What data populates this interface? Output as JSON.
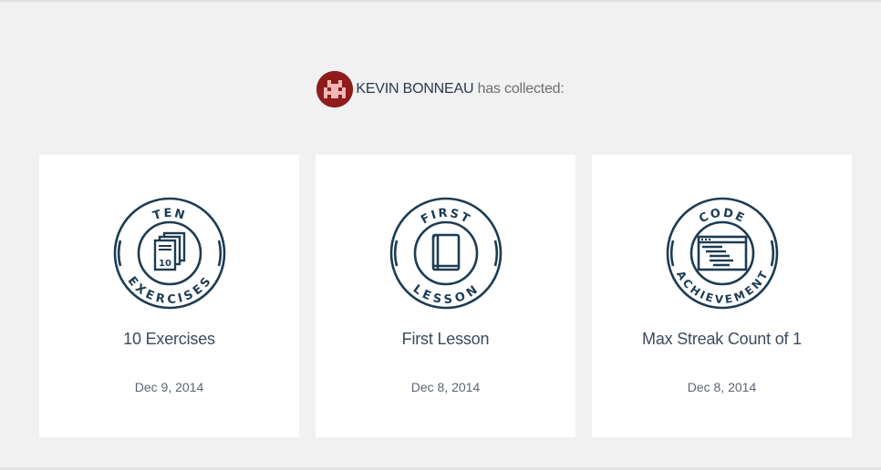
{
  "header": {
    "user_name": "KEVIN BONNEAU",
    "suffix": "has collected:",
    "avatar_icon": "space-invader-avatar",
    "avatar_color": "#8f1b1b"
  },
  "accent_color": "#1d3c52",
  "badges": [
    {
      "ring_top": "TEN",
      "ring_bottom": "EXERCISES",
      "icon": "stacked-pages-icon",
      "icon_number": "10",
      "title": "10 Exercises",
      "date": "Dec 9, 2014"
    },
    {
      "ring_top": "FIRST",
      "ring_bottom": "LESSON",
      "icon": "book-icon",
      "title": "First Lesson",
      "date": "Dec 8, 2014"
    },
    {
      "ring_top": "CODE",
      "ring_bottom": "ACHIEVEMENT",
      "icon": "code-window-icon",
      "title": "Max Streak Count of 1",
      "date": "Dec 8, 2014"
    }
  ]
}
